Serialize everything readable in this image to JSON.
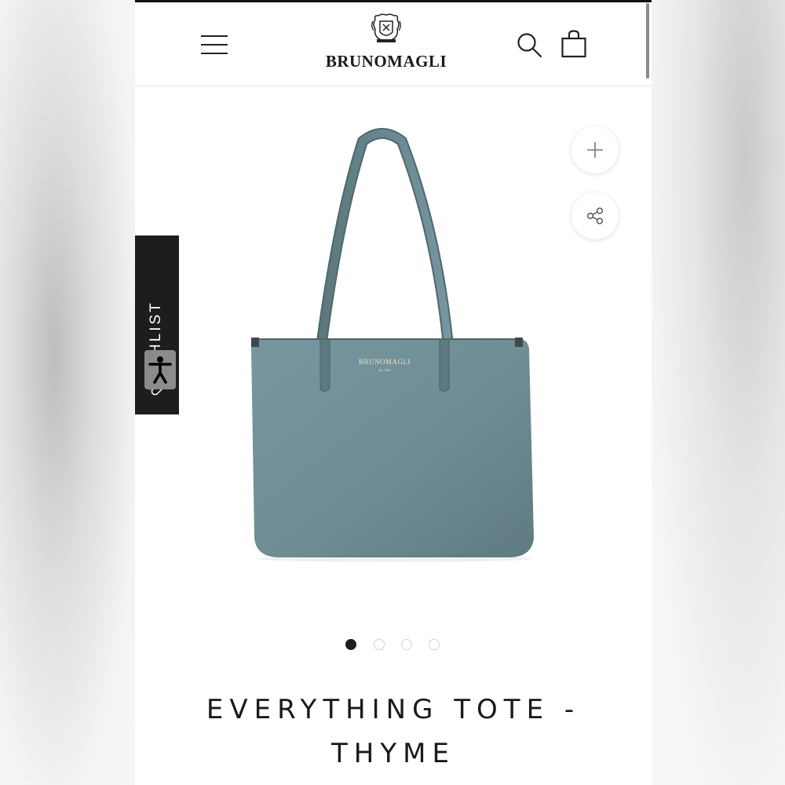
{
  "brand": {
    "name": "BRUNOMAGLI",
    "bag_stamp": "BRUNOMAGLI",
    "bag_stamp_sub": "Est. 1936"
  },
  "header": {
    "menu_icon": "hamburger-icon",
    "search_icon": "search-icon",
    "cart_icon": "bag-icon"
  },
  "actions": {
    "zoom_icon": "plus-icon",
    "share_icon": "share-icon"
  },
  "wishlist": {
    "label": "WISHLIST",
    "icon": "heart-icon"
  },
  "accessibility": {
    "icon": "accessibility-icon"
  },
  "gallery": {
    "current_index": 1,
    "total": 4
  },
  "product": {
    "title_line1": "EVERYTHING TOTE -",
    "title_line2": "THYME",
    "color_swatch": "#6f8d93"
  },
  "colors": {
    "header_text": "#1a1a1a",
    "wishlist_bg": "#1d1d1d",
    "bag": "#6f8d93"
  }
}
